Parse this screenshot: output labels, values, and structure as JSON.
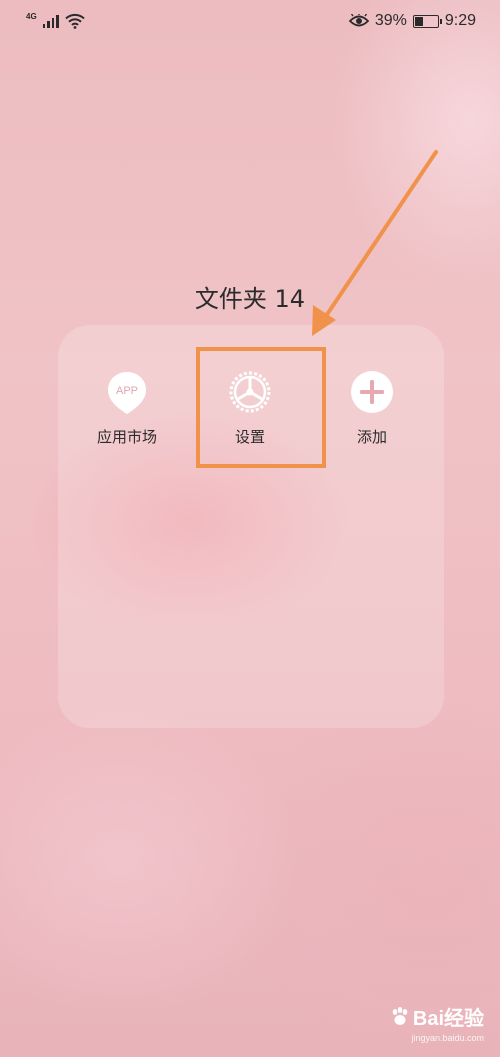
{
  "status_bar": {
    "network": "4G",
    "battery_percent": "39%",
    "battery_level": 0.39,
    "time": "9:29",
    "icons": [
      "signal-icon",
      "wifi-icon",
      "eye-comfort-icon",
      "battery-icon"
    ]
  },
  "folder": {
    "title": "文件夹 14",
    "apps": [
      {
        "label": "应用市场",
        "icon": "app-store-icon",
        "icon_text": "APP"
      },
      {
        "label": "设置",
        "icon": "settings-gear-icon"
      },
      {
        "label": "添加",
        "icon": "plus-circle-icon"
      }
    ]
  },
  "annotation": {
    "color": "#f0924a",
    "highlight_target": "设置"
  },
  "watermark": {
    "brand": "Bai经验",
    "site": "jingyan.baidu.com"
  }
}
